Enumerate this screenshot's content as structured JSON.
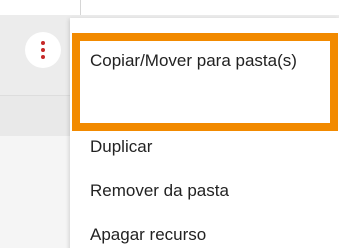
{
  "menu": {
    "items": [
      {
        "label": "Copiar/Mover para pasta(s)"
      },
      {
        "label": "Duplicar"
      },
      {
        "label": "Remover da pasta"
      },
      {
        "label": "Apagar recurso"
      }
    ]
  },
  "more_button": {
    "icon": "more-vertical-icon",
    "icon_color": "#c62828"
  },
  "highlight_color": "#f28a00"
}
